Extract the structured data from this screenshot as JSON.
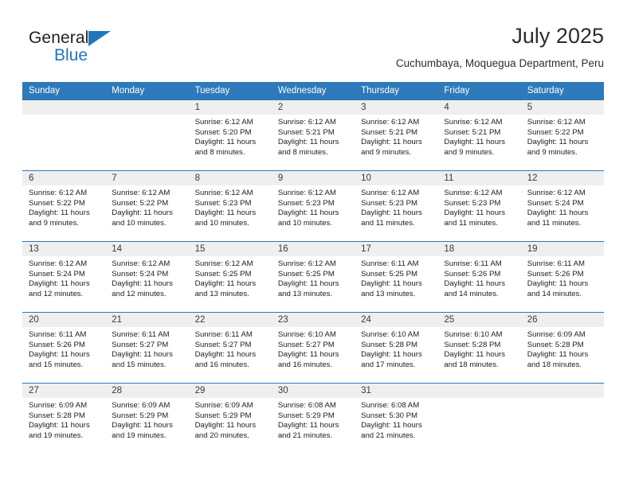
{
  "brand": {
    "name_top": "General",
    "name_bottom": "Blue",
    "top_color": "#231f20",
    "bottom_color": "#1f76bc",
    "triangle_icon": "blue-triangle-icon"
  },
  "header": {
    "title": "July 2025",
    "subtitle": "Cuchumbaya, Moquegua Department, Peru"
  },
  "theme": {
    "header_blue": "#2e79b9",
    "daynum_gray": "#efeff0",
    "text": "#1d1d1d"
  },
  "weekday_headers": [
    "Sunday",
    "Monday",
    "Tuesday",
    "Wednesday",
    "Thursday",
    "Friday",
    "Saturday"
  ],
  "weeks": [
    [
      {
        "day": "",
        "empty": true
      },
      {
        "day": "",
        "empty": true
      },
      {
        "day": "1",
        "sunrise": "Sunrise: 6:12 AM",
        "sunset": "Sunset: 5:20 PM",
        "daylight1": "Daylight: 11 hours",
        "daylight2": "and 8 minutes."
      },
      {
        "day": "2",
        "sunrise": "Sunrise: 6:12 AM",
        "sunset": "Sunset: 5:21 PM",
        "daylight1": "Daylight: 11 hours",
        "daylight2": "and 8 minutes."
      },
      {
        "day": "3",
        "sunrise": "Sunrise: 6:12 AM",
        "sunset": "Sunset: 5:21 PM",
        "daylight1": "Daylight: 11 hours",
        "daylight2": "and 9 minutes."
      },
      {
        "day": "4",
        "sunrise": "Sunrise: 6:12 AM",
        "sunset": "Sunset: 5:21 PM",
        "daylight1": "Daylight: 11 hours",
        "daylight2": "and 9 minutes."
      },
      {
        "day": "5",
        "sunrise": "Sunrise: 6:12 AM",
        "sunset": "Sunset: 5:22 PM",
        "daylight1": "Daylight: 11 hours",
        "daylight2": "and 9 minutes."
      }
    ],
    [
      {
        "day": "6",
        "sunrise": "Sunrise: 6:12 AM",
        "sunset": "Sunset: 5:22 PM",
        "daylight1": "Daylight: 11 hours",
        "daylight2": "and 9 minutes."
      },
      {
        "day": "7",
        "sunrise": "Sunrise: 6:12 AM",
        "sunset": "Sunset: 5:22 PM",
        "daylight1": "Daylight: 11 hours",
        "daylight2": "and 10 minutes."
      },
      {
        "day": "8",
        "sunrise": "Sunrise: 6:12 AM",
        "sunset": "Sunset: 5:23 PM",
        "daylight1": "Daylight: 11 hours",
        "daylight2": "and 10 minutes."
      },
      {
        "day": "9",
        "sunrise": "Sunrise: 6:12 AM",
        "sunset": "Sunset: 5:23 PM",
        "daylight1": "Daylight: 11 hours",
        "daylight2": "and 10 minutes."
      },
      {
        "day": "10",
        "sunrise": "Sunrise: 6:12 AM",
        "sunset": "Sunset: 5:23 PM",
        "daylight1": "Daylight: 11 hours",
        "daylight2": "and 11 minutes."
      },
      {
        "day": "11",
        "sunrise": "Sunrise: 6:12 AM",
        "sunset": "Sunset: 5:23 PM",
        "daylight1": "Daylight: 11 hours",
        "daylight2": "and 11 minutes."
      },
      {
        "day": "12",
        "sunrise": "Sunrise: 6:12 AM",
        "sunset": "Sunset: 5:24 PM",
        "daylight1": "Daylight: 11 hours",
        "daylight2": "and 11 minutes."
      }
    ],
    [
      {
        "day": "13",
        "sunrise": "Sunrise: 6:12 AM",
        "sunset": "Sunset: 5:24 PM",
        "daylight1": "Daylight: 11 hours",
        "daylight2": "and 12 minutes."
      },
      {
        "day": "14",
        "sunrise": "Sunrise: 6:12 AM",
        "sunset": "Sunset: 5:24 PM",
        "daylight1": "Daylight: 11 hours",
        "daylight2": "and 12 minutes."
      },
      {
        "day": "15",
        "sunrise": "Sunrise: 6:12 AM",
        "sunset": "Sunset: 5:25 PM",
        "daylight1": "Daylight: 11 hours",
        "daylight2": "and 13 minutes."
      },
      {
        "day": "16",
        "sunrise": "Sunrise: 6:12 AM",
        "sunset": "Sunset: 5:25 PM",
        "daylight1": "Daylight: 11 hours",
        "daylight2": "and 13 minutes."
      },
      {
        "day": "17",
        "sunrise": "Sunrise: 6:11 AM",
        "sunset": "Sunset: 5:25 PM",
        "daylight1": "Daylight: 11 hours",
        "daylight2": "and 13 minutes."
      },
      {
        "day": "18",
        "sunrise": "Sunrise: 6:11 AM",
        "sunset": "Sunset: 5:26 PM",
        "daylight1": "Daylight: 11 hours",
        "daylight2": "and 14 minutes."
      },
      {
        "day": "19",
        "sunrise": "Sunrise: 6:11 AM",
        "sunset": "Sunset: 5:26 PM",
        "daylight1": "Daylight: 11 hours",
        "daylight2": "and 14 minutes."
      }
    ],
    [
      {
        "day": "20",
        "sunrise": "Sunrise: 6:11 AM",
        "sunset": "Sunset: 5:26 PM",
        "daylight1": "Daylight: 11 hours",
        "daylight2": "and 15 minutes."
      },
      {
        "day": "21",
        "sunrise": "Sunrise: 6:11 AM",
        "sunset": "Sunset: 5:27 PM",
        "daylight1": "Daylight: 11 hours",
        "daylight2": "and 15 minutes."
      },
      {
        "day": "22",
        "sunrise": "Sunrise: 6:11 AM",
        "sunset": "Sunset: 5:27 PM",
        "daylight1": "Daylight: 11 hours",
        "daylight2": "and 16 minutes."
      },
      {
        "day": "23",
        "sunrise": "Sunrise: 6:10 AM",
        "sunset": "Sunset: 5:27 PM",
        "daylight1": "Daylight: 11 hours",
        "daylight2": "and 16 minutes."
      },
      {
        "day": "24",
        "sunrise": "Sunrise: 6:10 AM",
        "sunset": "Sunset: 5:28 PM",
        "daylight1": "Daylight: 11 hours",
        "daylight2": "and 17 minutes."
      },
      {
        "day": "25",
        "sunrise": "Sunrise: 6:10 AM",
        "sunset": "Sunset: 5:28 PM",
        "daylight1": "Daylight: 11 hours",
        "daylight2": "and 18 minutes."
      },
      {
        "day": "26",
        "sunrise": "Sunrise: 6:09 AM",
        "sunset": "Sunset: 5:28 PM",
        "daylight1": "Daylight: 11 hours",
        "daylight2": "and 18 minutes."
      }
    ],
    [
      {
        "day": "27",
        "sunrise": "Sunrise: 6:09 AM",
        "sunset": "Sunset: 5:28 PM",
        "daylight1": "Daylight: 11 hours",
        "daylight2": "and 19 minutes."
      },
      {
        "day": "28",
        "sunrise": "Sunrise: 6:09 AM",
        "sunset": "Sunset: 5:29 PM",
        "daylight1": "Daylight: 11 hours",
        "daylight2": "and 19 minutes."
      },
      {
        "day": "29",
        "sunrise": "Sunrise: 6:09 AM",
        "sunset": "Sunset: 5:29 PM",
        "daylight1": "Daylight: 11 hours",
        "daylight2": "and 20 minutes."
      },
      {
        "day": "30",
        "sunrise": "Sunrise: 6:08 AM",
        "sunset": "Sunset: 5:29 PM",
        "daylight1": "Daylight: 11 hours",
        "daylight2": "and 21 minutes."
      },
      {
        "day": "31",
        "sunrise": "Sunrise: 6:08 AM",
        "sunset": "Sunset: 5:30 PM",
        "daylight1": "Daylight: 11 hours",
        "daylight2": "and 21 minutes."
      },
      {
        "day": "",
        "empty": true
      },
      {
        "day": "",
        "empty": true
      }
    ]
  ]
}
